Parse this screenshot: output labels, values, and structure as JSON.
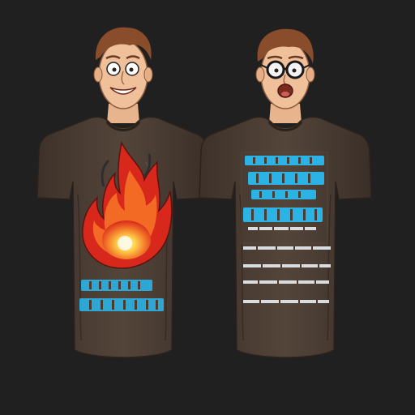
{
  "scene": {
    "background": "#202020",
    "figures": [
      {
        "id": "left",
        "shirt_color": "#4a3c33",
        "graphic": "flame-icon",
        "text_color": "#2bb3e6"
      },
      {
        "id": "right",
        "shirt_color": "#4a3c33",
        "graphic": "text-block",
        "text_color": "#2bb3e6"
      }
    ]
  }
}
